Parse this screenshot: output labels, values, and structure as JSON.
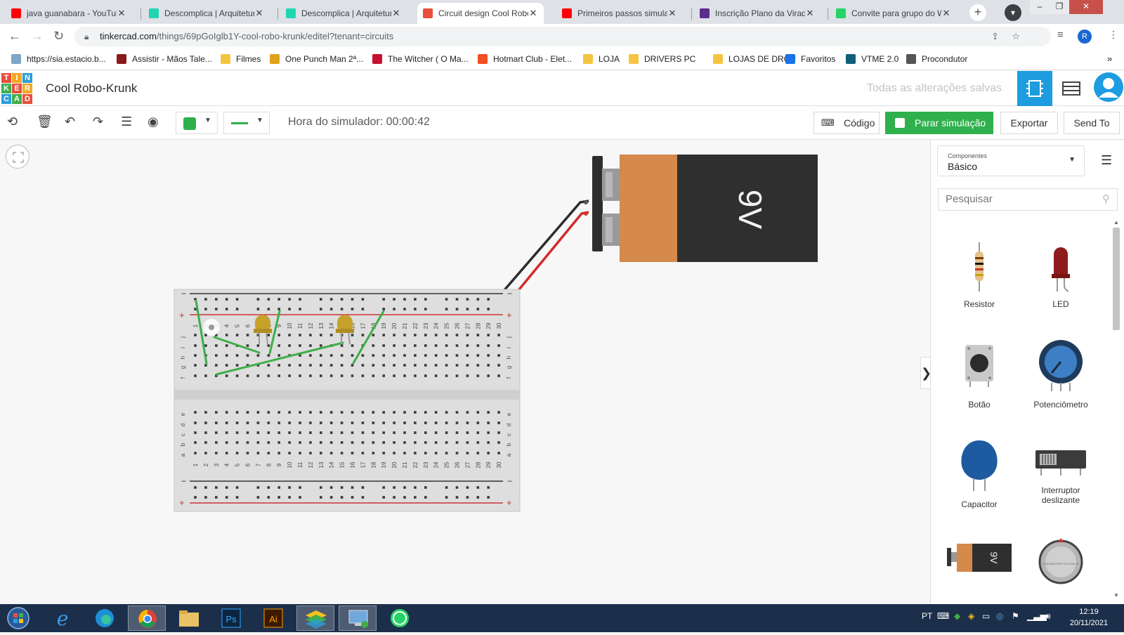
{
  "browser": {
    "tabs": [
      {
        "title": "java guanabara - YouTub",
        "favicon_color": "#ff0000"
      },
      {
        "title": "Descomplica | Arquitetur",
        "favicon_color": "#20d6b1"
      },
      {
        "title": "Descomplica | Arquitetur",
        "favicon_color": "#20d6b1"
      },
      {
        "title": "Circuit design Cool Robo",
        "favicon_color": "#e94e3d",
        "active": true
      },
      {
        "title": "Primeiros passos simular",
        "favicon_color": "#ff0000"
      },
      {
        "title": "Inscrição Plano da Virada",
        "favicon_color": "#5b2d8e"
      },
      {
        "title": "Convite para grupo do W",
        "favicon_color": "#25d366"
      }
    ],
    "close_glyph": "✕",
    "new_tab_glyph": "+",
    "url_host": "tinkercad.com",
    "url_path": "/things/69pGoIglb1Y-cool-robo-krunk/editel?tenant=circuits",
    "profile_initial": "R",
    "bookmarks": [
      {
        "label": "https://sia.estacio.b...",
        "color": "#7fa6c9"
      },
      {
        "label": "Assistir - Mãos Tale...",
        "color": "#8b1a1a"
      },
      {
        "label": "Filmes",
        "color": "#f5c542"
      },
      {
        "label": "One Punch Man 2ª...",
        "color": "#e0a21a"
      },
      {
        "label": "The Witcher ( O Ma...",
        "color": "#c8102e"
      },
      {
        "label": "Hotmart Club - Elet...",
        "color": "#f04e23"
      },
      {
        "label": "LOJA",
        "color": "#f5c542"
      },
      {
        "label": "DRIVERS PC",
        "color": "#f5c542"
      },
      {
        "label": "LOJAS DE DROP",
        "color": "#f5c542"
      },
      {
        "label": "Favoritos",
        "color": "#1a73e8"
      },
      {
        "label": "VTME 2.0",
        "color": "#0f5e7a"
      },
      {
        "label": "Procondutor",
        "color": "#555555"
      }
    ],
    "more_bookmarks": "»"
  },
  "tinkercad": {
    "logo_letters": [
      "T",
      "I",
      "N",
      "K",
      "E",
      "R",
      "C",
      "A",
      "D"
    ],
    "logo_colors": [
      "#e94e3d",
      "#f4a821",
      "#2b9ed8",
      "#3fae49",
      "#e94e3d",
      "#f4a821",
      "#2b9ed8",
      "#3fae49",
      "#e94e3d"
    ],
    "project_title": "Cool Robo-Krunk",
    "save_status": "Todas as alterações salvas"
  },
  "toolbar": {
    "sim_time": "Hora do simulador: 00:00:42",
    "code_label": "Código",
    "stop_label": "Parar simulação",
    "export_label": "Exportar",
    "send_label": "Send To",
    "wire_color": "#2fb04d"
  },
  "circuit": {
    "battery_label": "9V",
    "row_letters_top": [
      "j",
      "i",
      "h",
      "g",
      "f"
    ],
    "row_letters_bottom": [
      "e",
      "d",
      "c",
      "b",
      "a"
    ],
    "column_numbers": [
      "1",
      "2",
      "3",
      "4",
      "5",
      "6",
      "7",
      "8",
      "9",
      "10",
      "11",
      "12",
      "13",
      "14",
      "15",
      "16",
      "17",
      "18",
      "19",
      "20",
      "21",
      "22",
      "23",
      "24",
      "25",
      "26",
      "27",
      "28",
      "29",
      "30"
    ],
    "rail_minus": "−",
    "rail_plus": "+"
  },
  "panel": {
    "select_label": "Componentes",
    "select_value": "Básico",
    "search_placeholder": "Pesquisar",
    "collapse_glyph": "❯",
    "components": [
      {
        "label": "Resistor"
      },
      {
        "label": "LED"
      },
      {
        "label": "Botão"
      },
      {
        "label": "Potenciômetro"
      },
      {
        "label": "Capacitor"
      },
      {
        "label": "Interruptor deslizante"
      },
      {
        "battery_text": "9V"
      },
      {
        "coin_text": "COIN BATTERY CR 2032 3V"
      }
    ]
  },
  "taskbar": {
    "lang": "PT",
    "time": "12:19",
    "date": "20/11/2021",
    "apps": [
      "start",
      "ie",
      "edge",
      "chrome",
      "explorer",
      "photoshop",
      "illustrator",
      "bluestacks",
      "remote",
      "whatsapp"
    ]
  }
}
